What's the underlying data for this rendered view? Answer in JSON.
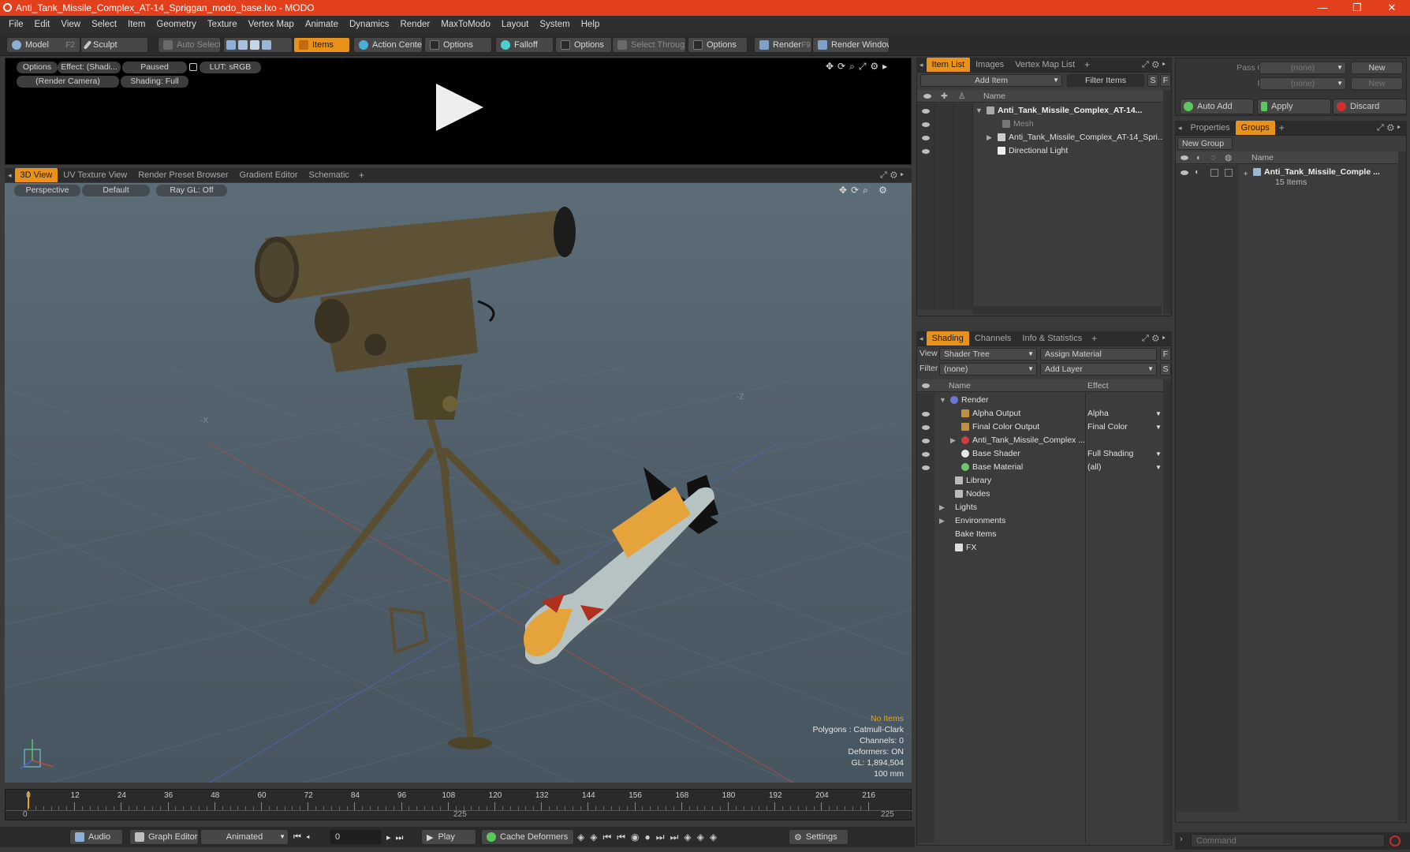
{
  "window": {
    "title": "Anti_Tank_Missile_Complex_AT-14_Spriggan_modo_base.lxo - MODO",
    "minimize": "—",
    "maximize": "❐",
    "close": "✕"
  },
  "menu": [
    "File",
    "Edit",
    "View",
    "Select",
    "Item",
    "Geometry",
    "Texture",
    "Vertex Map",
    "Animate",
    "Dynamics",
    "Render",
    "MaxToModo",
    "Layout",
    "System",
    "Help"
  ],
  "toolbar": {
    "model": "Model",
    "model_key": "F2",
    "sculpt": "Sculpt",
    "auto_select": "Auto Select",
    "items": "Items",
    "action_center": "Action Center",
    "options1": "Options",
    "falloff": "Falloff",
    "options2": "Options",
    "select_through": "Select Through",
    "options3": "Options",
    "render": "Render",
    "render_key": "F9",
    "render_window": "Render Window"
  },
  "preview": {
    "options": "Options",
    "effect": "Effect: (Shadi...",
    "paused": "Paused",
    "lut": "LUT: sRGB",
    "camera": "(Render Camera)",
    "shading": "Shading: Full"
  },
  "viewport_tabs": [
    "3D View",
    "UV Texture View",
    "Render Preset Browser",
    "Gradient Editor",
    "Schematic"
  ],
  "viewport": {
    "perspective": "Perspective",
    "default": "Default",
    "raygl": "Ray GL: Off",
    "axis_x": "-X",
    "axis_z": "-Z",
    "info": {
      "items": "No Items",
      "polygons": "Polygons : Catmull-Clark",
      "channels": "Channels: 0",
      "deformers": "Deformers: ON",
      "gl": "GL: 1,894,504",
      "scale": "100 mm"
    }
  },
  "timeline": {
    "ticks": [
      "0",
      "12",
      "24",
      "36",
      "48",
      "60",
      "72",
      "84",
      "96",
      "108",
      "120",
      "132",
      "144",
      "156",
      "168",
      "180",
      "192",
      "204",
      "216"
    ],
    "start": "0",
    "mid": "225",
    "end": "225"
  },
  "transport": {
    "audio": "Audio",
    "graph_editor": "Graph Editor",
    "animated": "Animated",
    "frame": "0",
    "play": "Play",
    "cache_deformers": "Cache Deformers",
    "settings": "Settings"
  },
  "item_list": {
    "tabs": [
      "Item List",
      "Images",
      "Vertex Map List"
    ],
    "add_item": "Add Item",
    "filter_items": "Filter Items",
    "s": "S",
    "f": "F",
    "col_name": "Name",
    "rows": [
      {
        "label": "Anti_Tank_Missile_Complex_AT-14...",
        "indent": 0
      },
      {
        "label": "Mesh",
        "indent": 1
      },
      {
        "label": "Anti_Tank_Missile_Complex_AT-14_Spri...",
        "indent": 1
      },
      {
        "label": "Directional Light",
        "indent": 1
      }
    ]
  },
  "pass_groups": {
    "pass_label": "Pass Groups",
    "pass_value": "(none)",
    "passes_label": "Passes",
    "passes_value": "(none)",
    "new1": "New",
    "new2": "New",
    "auto_add": "Auto Add",
    "apply": "Apply",
    "discard": "Discard"
  },
  "groups": {
    "tabs": [
      "Properties",
      "Groups"
    ],
    "new_group": "New Group",
    "col_name": "Name",
    "item_name": "Anti_Tank_Missile_Comple ...",
    "item_count": "15 Items"
  },
  "shading": {
    "tabs": [
      "Shading",
      "Channels",
      "Info & Statistics"
    ],
    "view_label": "View",
    "view_value": "Shader Tree",
    "assign_material": "Assign Material",
    "f": "F",
    "filter_label": "Filter",
    "filter_value": "(none)",
    "add_layer": "Add Layer",
    "s": "S",
    "col_name": "Name",
    "col_effect": "Effect",
    "rows": [
      {
        "label": "Render",
        "effect": ""
      },
      {
        "label": "Alpha Output",
        "effect": "Alpha"
      },
      {
        "label": "Final Color Output",
        "effect": "Final Color"
      },
      {
        "label": "Anti_Tank_Missile_Complex ...",
        "effect": ""
      },
      {
        "label": "Base Shader",
        "effect": "Full Shading"
      },
      {
        "label": "Base Material",
        "effect": "(all)"
      },
      {
        "label": "Library",
        "effect": ""
      },
      {
        "label": "Nodes",
        "effect": ""
      },
      {
        "label": "Lights",
        "effect": ""
      },
      {
        "label": "Environments",
        "effect": ""
      },
      {
        "label": "Bake Items",
        "effect": ""
      },
      {
        "label": "FX",
        "effect": ""
      }
    ]
  },
  "command": {
    "placeholder": "Command"
  },
  "colors": {
    "accent": "#e8921c",
    "titlebar": "#e2401d",
    "launcher": "#5e5236",
    "missile_body": "#b7c3c3",
    "missile_band": "#e5a33b"
  }
}
